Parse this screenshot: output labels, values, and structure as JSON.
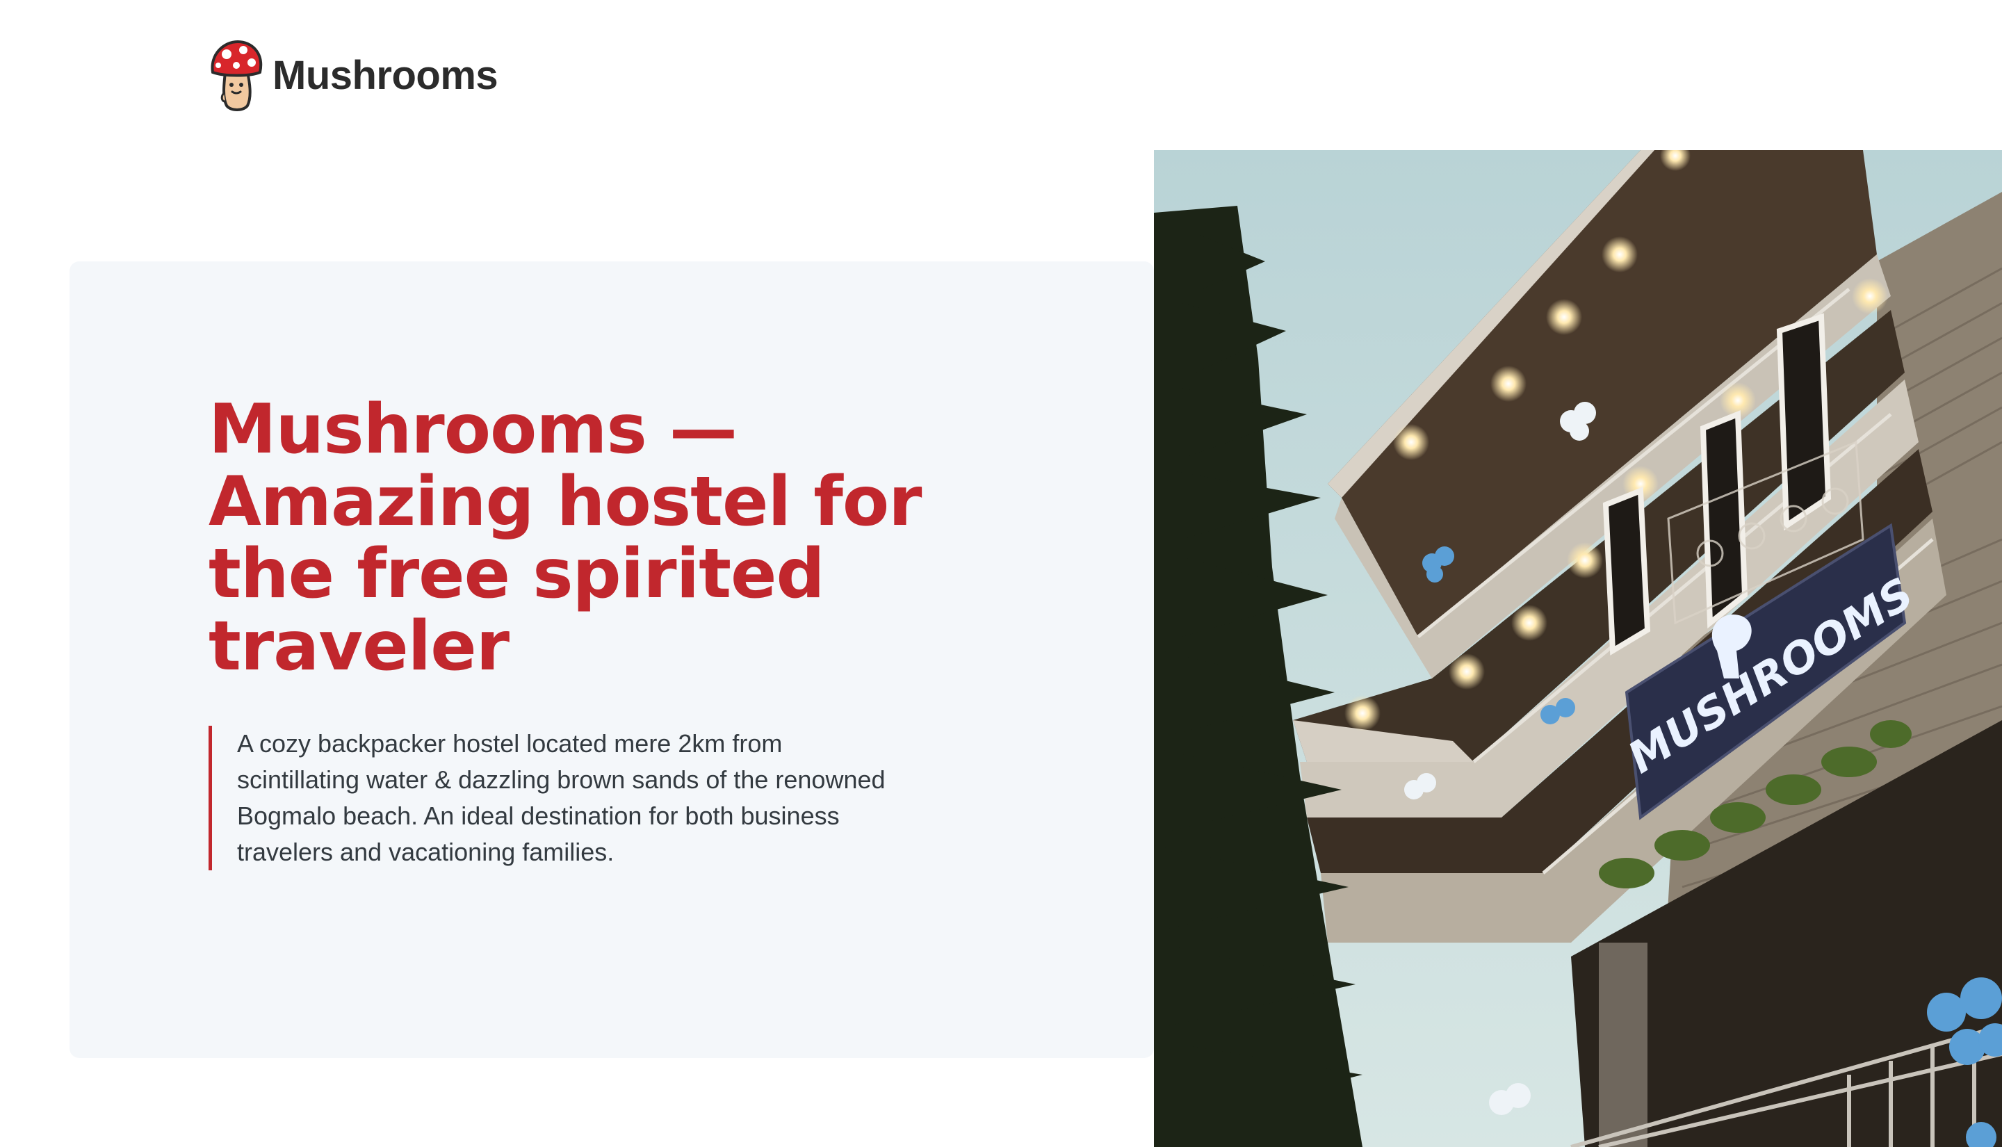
{
  "brand": {
    "name": "Mushrooms",
    "logo_icon": "mushroom-mascot-icon",
    "accent_color": "#c1272d"
  },
  "hero": {
    "title": "Mushrooms — Amazing hostel for the free spirited traveler",
    "description": "A cozy backpacker hostel located mere 2km from scintillating water & dazzling brown sands of the renowned Bogmalo beach. An ideal destination for both business travelers and vacationing families.",
    "photo": {
      "sign_text": "MUSHROOMS"
    }
  }
}
